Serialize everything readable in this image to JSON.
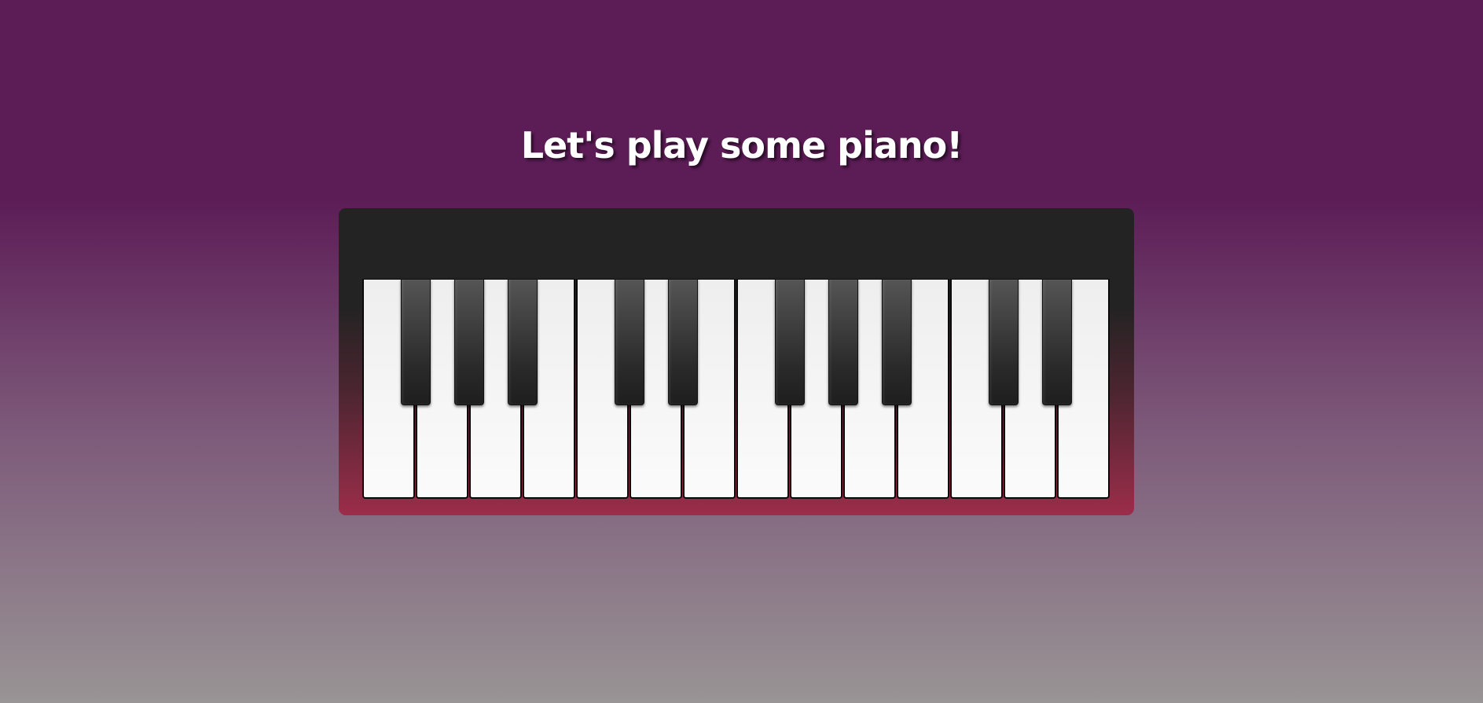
{
  "page": {
    "title": "Let's play some piano!"
  },
  "piano": {
    "white_key_count": 14,
    "black_keys_after_white": [
      0,
      1,
      2,
      4,
      5,
      7,
      8,
      9,
      11,
      12
    ]
  },
  "colors": {
    "background_top": "#5c1c56",
    "background_bottom": "#999495",
    "piano_case_top": "#232323",
    "piano_case_bottom": "#9c2d4a",
    "white_key": "#f5f5f5",
    "black_key": "#2a2a2a"
  }
}
